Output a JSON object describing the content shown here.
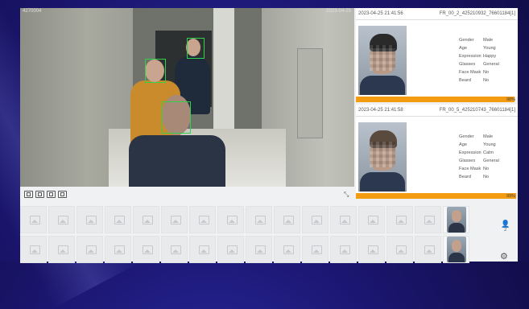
{
  "video": {
    "timestamp_left": "4270004",
    "timestamp_right": "2023-04-25"
  },
  "toolbar": {
    "icons": [
      "screenshot-icon",
      "record-icon",
      "window-icon",
      "pip-icon"
    ],
    "fullscreen_icon": "expand-icon"
  },
  "cards": [
    {
      "timestamp": "2023-04-25 21:41:56",
      "id": "FR_00_2_425210932_76601184[1]",
      "attributes": [
        {
          "key": "Gender",
          "value": "Male"
        },
        {
          "key": "Age",
          "value": "Young"
        },
        {
          "key": "Expression",
          "value": "Happy"
        },
        {
          "key": "Glasses",
          "value": "General"
        },
        {
          "key": "Face Mask",
          "value": "No"
        },
        {
          "key": "Beard",
          "value": "No"
        }
      ],
      "score_label": "98%",
      "score": 0.98
    },
    {
      "timestamp": "2023-04-25 21:41:58",
      "id": "FR_00_5_425210743_76601184[1]",
      "attributes": [
        {
          "key": "Gender",
          "value": "Male"
        },
        {
          "key": "Age",
          "value": "Young"
        },
        {
          "key": "Expression",
          "value": "Calm"
        },
        {
          "key": "Glasses",
          "value": "General"
        },
        {
          "key": "Face Mask",
          "value": "No"
        },
        {
          "key": "Beard",
          "value": "No"
        }
      ],
      "score_label": "99%",
      "score": 0.99
    }
  ],
  "thumbnails": {
    "count": "2",
    "person_icon": "person-icon",
    "settings_icon": "gear-icon"
  },
  "colors": {
    "face_box": "#2fd24a",
    "score_bar": "#f39c12",
    "background": "#1b1670"
  }
}
